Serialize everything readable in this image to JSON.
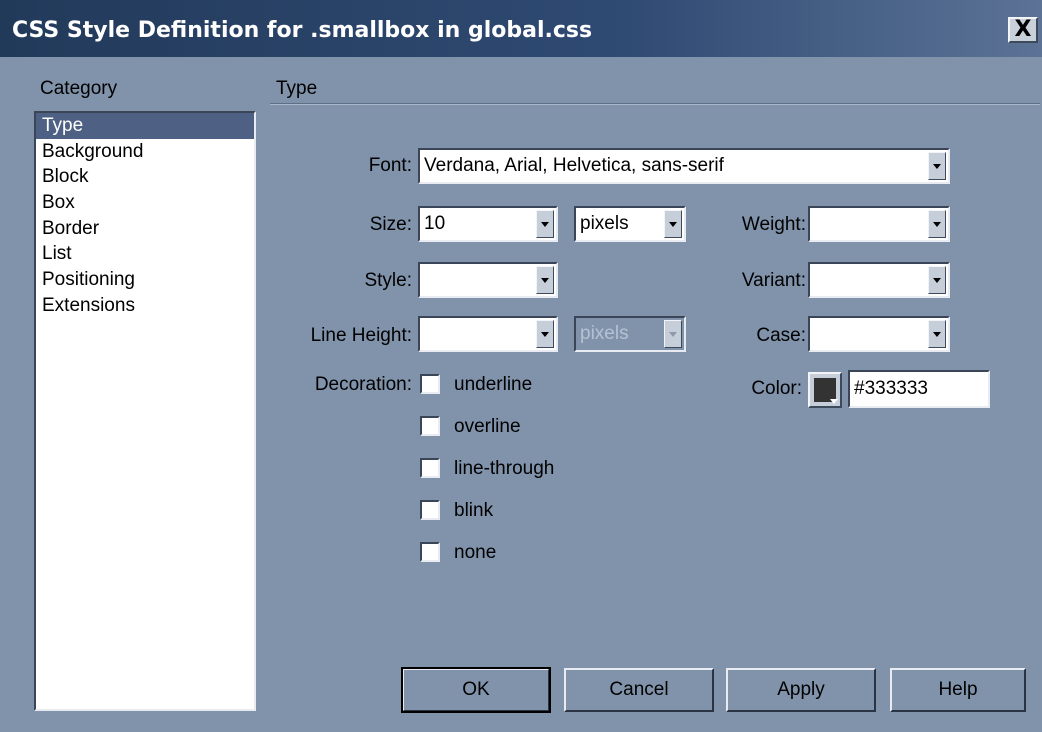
{
  "window": {
    "title": "CSS Style Definition for .smallbox in global.css",
    "close_label": "X"
  },
  "category": {
    "header": "Category",
    "items": [
      "Type",
      "Background",
      "Block",
      "Box",
      "Border",
      "List",
      "Positioning",
      "Extensions"
    ],
    "selected": "Type"
  },
  "panel": {
    "title": "Type"
  },
  "form": {
    "font_label": "Font:",
    "font_value": "Verdana, Arial, Helvetica, sans-serif",
    "size_label": "Size:",
    "size_value": "10",
    "size_unit": "pixels",
    "weight_label": "Weight:",
    "weight_value": "",
    "style_label": "Style:",
    "style_value": "",
    "variant_label": "Variant:",
    "variant_value": "",
    "line_height_label": "Line Height:",
    "line_height_value": "",
    "line_height_unit": "pixels",
    "case_label": "Case:",
    "case_value": "",
    "decoration_label": "Decoration:",
    "decorations": [
      "underline",
      "overline",
      "line-through",
      "blink",
      "none"
    ],
    "color_label": "Color:",
    "color_value": "#333333",
    "swatch_color": "#333333"
  },
  "buttons": {
    "ok": "OK",
    "cancel": "Cancel",
    "apply": "Apply",
    "help": "Help"
  }
}
